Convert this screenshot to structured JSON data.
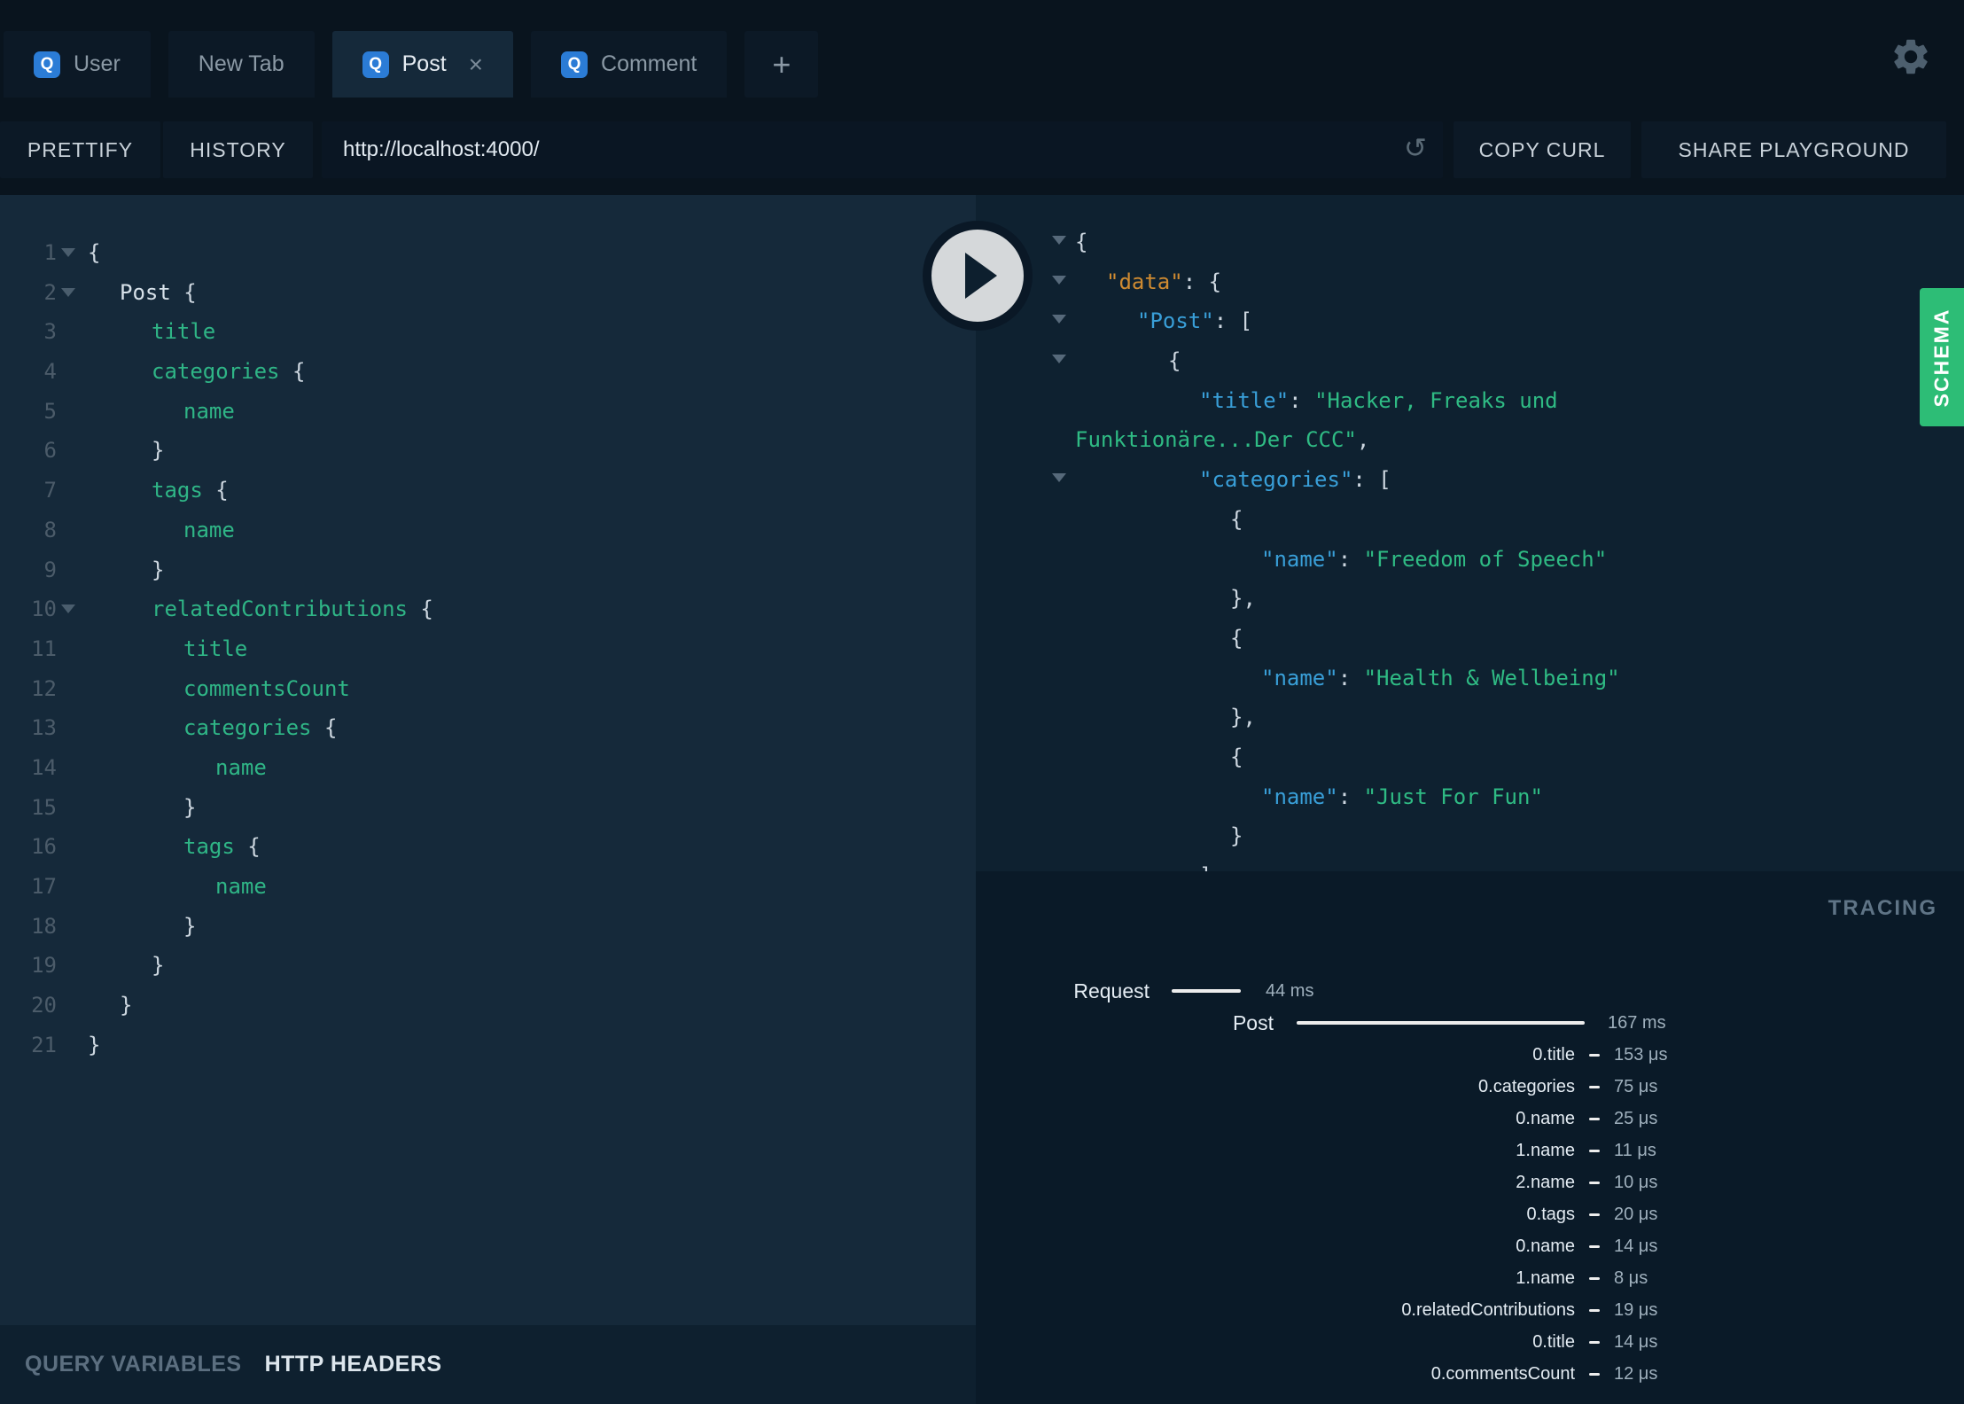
{
  "colors": {
    "badge_blue": "#2b7cd6",
    "field_green": "#2fb586",
    "string_green": "#2fbb84",
    "key_blue": "#399fd8",
    "special_orange": "#ce8a31",
    "schema_green": "#2dbd76"
  },
  "tabs": {
    "items": [
      {
        "badge": "Q",
        "label": "User"
      },
      {
        "badge": "",
        "label": "New Tab"
      },
      {
        "badge": "Q",
        "label": "Post"
      },
      {
        "badge": "Q",
        "label": "Comment"
      }
    ],
    "close_icon": "×",
    "add_icon": "+"
  },
  "toolbar": {
    "prettify": "PRETTIFY",
    "history": "HISTORY",
    "url": "http://localhost:4000/",
    "reload_icon": "↺",
    "copy_curl": "COPY CURL",
    "share": "SHARE PLAYGROUND"
  },
  "query_editor": {
    "lines": [
      {
        "num": 1,
        "tokens": [
          {
            "t": "punct",
            "s": "{"
          }
        ]
      },
      {
        "num": 2,
        "tokens": [
          {
            "t": "root",
            "s": "Post"
          },
          {
            "t": "punct",
            "s": " {"
          }
        ]
      },
      {
        "num": 3,
        "tokens": [
          {
            "t": "field",
            "s": "title"
          }
        ]
      },
      {
        "num": 4,
        "tokens": [
          {
            "t": "field",
            "s": "categories"
          },
          {
            "t": "punct",
            "s": " {"
          }
        ]
      },
      {
        "num": 5,
        "tokens": [
          {
            "t": "field",
            "s": "name"
          }
        ]
      },
      {
        "num": 6,
        "tokens": [
          {
            "t": "punct",
            "s": "}"
          }
        ]
      },
      {
        "num": 7,
        "tokens": [
          {
            "t": "field",
            "s": "tags"
          },
          {
            "t": "punct",
            "s": " {"
          }
        ]
      },
      {
        "num": 8,
        "tokens": [
          {
            "t": "field",
            "s": "name"
          }
        ]
      },
      {
        "num": 9,
        "tokens": [
          {
            "t": "punct",
            "s": "}"
          }
        ]
      },
      {
        "num": 10,
        "tokens": [
          {
            "t": "field",
            "s": "relatedContributions"
          },
          {
            "t": "punct",
            "s": " {"
          }
        ]
      },
      {
        "num": 11,
        "tokens": [
          {
            "t": "field",
            "s": "title"
          }
        ]
      },
      {
        "num": 12,
        "tokens": [
          {
            "t": "field",
            "s": "commentsCount"
          }
        ]
      },
      {
        "num": 13,
        "tokens": [
          {
            "t": "field",
            "s": "categories"
          },
          {
            "t": "punct",
            "s": " {"
          }
        ]
      },
      {
        "num": 14,
        "tokens": [
          {
            "t": "field",
            "s": "name"
          }
        ]
      },
      {
        "num": 15,
        "tokens": [
          {
            "t": "punct",
            "s": "}"
          }
        ]
      },
      {
        "num": 16,
        "tokens": [
          {
            "t": "field",
            "s": "tags"
          },
          {
            "t": "punct",
            "s": " {"
          }
        ]
      },
      {
        "num": 17,
        "tokens": [
          {
            "t": "field",
            "s": "name"
          }
        ]
      },
      {
        "num": 18,
        "tokens": [
          {
            "t": "punct",
            "s": "}"
          }
        ]
      },
      {
        "num": 19,
        "tokens": [
          {
            "t": "punct",
            "s": "}"
          }
        ]
      },
      {
        "num": 20,
        "tokens": [
          {
            "t": "punct",
            "s": "}"
          }
        ]
      },
      {
        "num": 21,
        "tokens": [
          {
            "t": "punct",
            "s": "}"
          }
        ]
      }
    ]
  },
  "response": {
    "lines": [
      {
        "tokens": [
          {
            "t": "punct",
            "s": "{"
          }
        ]
      },
      {
        "tokens": [
          {
            "t": "keyd",
            "s": "\"data\""
          },
          {
            "t": "punct",
            "s": ": {"
          }
        ]
      },
      {
        "tokens": [
          {
            "t": "key",
            "s": "\"Post\""
          },
          {
            "t": "punct",
            "s": ": ["
          }
        ]
      },
      {
        "tokens": [
          {
            "t": "punct",
            "s": "{"
          }
        ]
      },
      {
        "tokens": [
          {
            "t": "key",
            "s": "\"title\""
          },
          {
            "t": "punct",
            "s": ": "
          },
          {
            "t": "str",
            "s": "\"Hacker, Freaks und"
          }
        ]
      },
      {
        "tokens": [
          {
            "t": "str",
            "s": "Funktionäre...Der CCC\""
          },
          {
            "t": "punct",
            "s": ","
          }
        ]
      },
      {
        "tokens": [
          {
            "t": "key",
            "s": "\"categories\""
          },
          {
            "t": "punct",
            "s": ": ["
          }
        ]
      },
      {
        "tokens": [
          {
            "t": "punct",
            "s": "{"
          }
        ]
      },
      {
        "tokens": [
          {
            "t": "key",
            "s": "\"name\""
          },
          {
            "t": "punct",
            "s": ": "
          },
          {
            "t": "str",
            "s": "\"Freedom of Speech\""
          }
        ]
      },
      {
        "tokens": [
          {
            "t": "punct",
            "s": "},"
          }
        ]
      },
      {
        "tokens": [
          {
            "t": "punct",
            "s": "{"
          }
        ]
      },
      {
        "tokens": [
          {
            "t": "key",
            "s": "\"name\""
          },
          {
            "t": "punct",
            "s": ": "
          },
          {
            "t": "str",
            "s": "\"Health & Wellbeing\""
          }
        ]
      },
      {
        "tokens": [
          {
            "t": "punct",
            "s": "},"
          }
        ]
      },
      {
        "tokens": [
          {
            "t": "punct",
            "s": "{"
          }
        ]
      },
      {
        "tokens": [
          {
            "t": "key",
            "s": "\"name\""
          },
          {
            "t": "punct",
            "s": ": "
          },
          {
            "t": "str",
            "s": "\"Just For Fun\""
          }
        ]
      },
      {
        "tokens": [
          {
            "t": "punct",
            "s": "}"
          }
        ]
      },
      {
        "tokens": [
          {
            "t": "punct",
            "s": "]"
          }
        ]
      }
    ]
  },
  "schema_tab": {
    "label": "SCHEMA"
  },
  "tracing": {
    "title": "TRACING",
    "rows": [
      {
        "label": "Request",
        "time": "44 ms"
      },
      {
        "label": "Post",
        "time": "167 ms"
      },
      {
        "label": "0.title",
        "time": "153 μs"
      },
      {
        "label": "0.categories",
        "time": "75 μs"
      },
      {
        "label": "0.name",
        "time": "25 μs"
      },
      {
        "label": "1.name",
        "time": "11 μs"
      },
      {
        "label": "2.name",
        "time": "10 μs"
      },
      {
        "label": "0.tags",
        "time": "20 μs"
      },
      {
        "label": "0.name",
        "time": "14 μs"
      },
      {
        "label": "1.name",
        "time": "8 μs"
      },
      {
        "label": "0.relatedContributions",
        "time": "19 μs"
      },
      {
        "label": "0.title",
        "time": "14 μs"
      },
      {
        "label": "0.commentsCount",
        "time": "12 μs"
      }
    ]
  },
  "footer": {
    "query_variables": "QUERY VARIABLES",
    "http_headers": "HTTP HEADERS"
  }
}
